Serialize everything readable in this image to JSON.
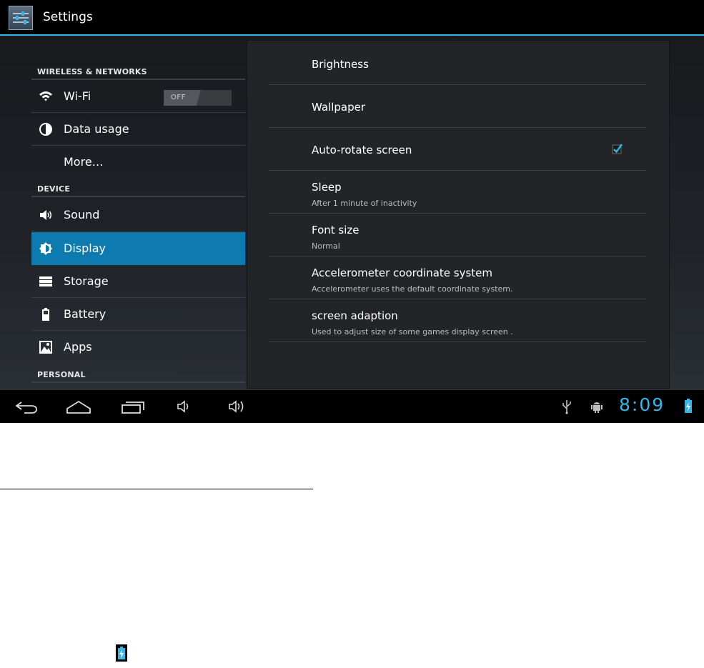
{
  "action_bar": {
    "title": "Settings",
    "icon": "settings-sliders-icon"
  },
  "sidebar": {
    "sections": [
      {
        "header": "WIRELESS & NETWORKS"
      },
      {
        "header": "DEVICE"
      },
      {
        "header": "PERSONAL"
      }
    ],
    "items": [
      {
        "label": "Wi-Fi",
        "icon": "wifi-icon",
        "toggle": "OFF"
      },
      {
        "label": "Data usage",
        "icon": "data-usage-icon"
      },
      {
        "label": "More…"
      },
      {
        "label": "Sound",
        "icon": "speaker-icon"
      },
      {
        "label": "Display",
        "icon": "display-brightness-icon",
        "selected": true
      },
      {
        "label": "Storage",
        "icon": "storage-icon"
      },
      {
        "label": "Battery",
        "icon": "battery-icon"
      },
      {
        "label": "Apps",
        "icon": "apps-icon"
      }
    ]
  },
  "display_settings": [
    {
      "title": "Brightness"
    },
    {
      "title": "Wallpaper"
    },
    {
      "title": "Auto-rotate screen",
      "checked": true
    },
    {
      "title": "Sleep",
      "summary": "After 1 minute of inactivity"
    },
    {
      "title": "Font size",
      "summary": "Normal"
    },
    {
      "title": "Accelerometer coordinate system",
      "summary": "Accelerometer uses the default coordinate system."
    },
    {
      "title": "screen adaption",
      "summary": "Used to adjust size of some games display screen ."
    }
  ],
  "nav_bar": {
    "buttons": [
      "back-icon",
      "home-icon",
      "recent-apps-icon",
      "volume-down-icon",
      "volume-up-icon"
    ],
    "status_icons": [
      "usb-icon",
      "android-debug-icon",
      "battery-charging-icon"
    ],
    "clock": "8:09"
  },
  "colors": {
    "accent": "#33b5e5",
    "selected": "#0d7ab0",
    "action_bar": "#000000"
  }
}
